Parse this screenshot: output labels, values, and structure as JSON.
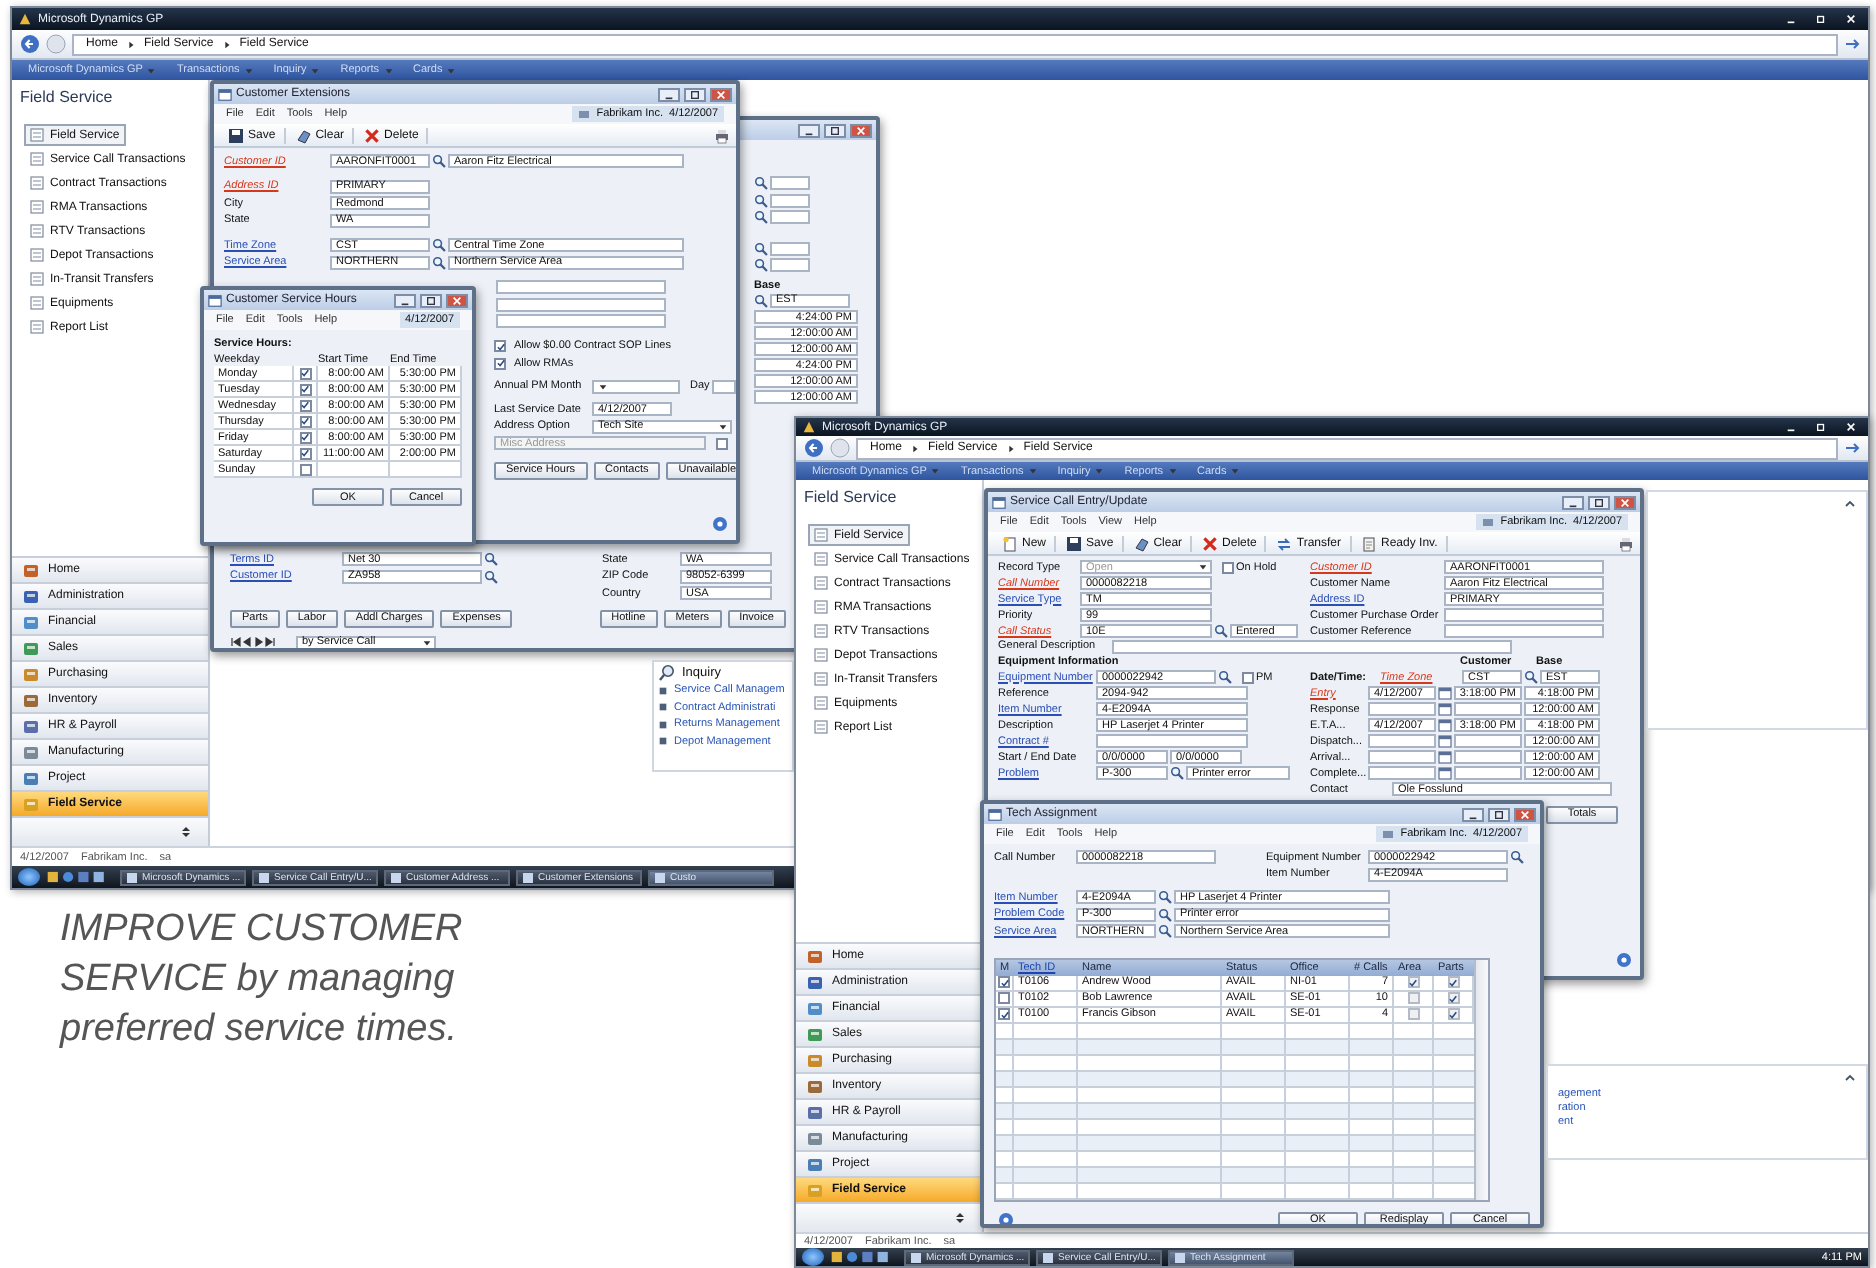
{
  "caption": "IMPROVE CUSTOMER SERVICE by managing preferred service times.",
  "screens": [
    {
      "title": "Microsoft Dynamics GP",
      "breadcrumb": [
        "Home",
        "Field Service",
        "Field Service"
      ],
      "menu": [
        "Microsoft Dynamics GP",
        "Transactions",
        "Inquiry",
        "Reports",
        "Cards"
      ],
      "pane_title": "Field Service",
      "nav_items": [
        {
          "label": "Field Service",
          "selected": true
        },
        {
          "label": "Service Call Transactions",
          "selected": false
        },
        {
          "label": "Contract Transactions",
          "selected": false
        },
        {
          "label": "RMA Transactions",
          "selected": false
        },
        {
          "label": "RTV Transactions",
          "selected": false
        },
        {
          "label": "Depot Transactions",
          "selected": false
        },
        {
          "label": "In-Transit Transfers",
          "selected": false
        },
        {
          "label": "Equipments",
          "selected": false
        },
        {
          "label": "Report List",
          "selected": false
        }
      ],
      "modules": [
        {
          "label": "Home",
          "selected": false
        },
        {
          "label": "Administration",
          "selected": false
        },
        {
          "label": "Financial",
          "selected": false
        },
        {
          "label": "Sales",
          "selected": false
        },
        {
          "label": "Purchasing",
          "selected": false
        },
        {
          "label": "Inventory",
          "selected": false
        },
        {
          "label": "HR & Payroll",
          "selected": false
        },
        {
          "label": "Manufacturing",
          "selected": false
        },
        {
          "label": "Project",
          "selected": false
        },
        {
          "label": "Field Service",
          "selected": true
        }
      ],
      "status_bar": [
        "4/12/2007",
        "Fabrikam Inc.",
        "sa"
      ],
      "taskbar": [
        {
          "label": "Microsoft Dynamics ...",
          "selected": false
        },
        {
          "label": "Service Call Entry/U...",
          "selected": false
        },
        {
          "label": "Customer Address ...",
          "selected": false
        },
        {
          "label": "Customer Extensions",
          "selected": false
        },
        {
          "label": "Custo",
          "selected": true
        }
      ],
      "windows": [
        {
          "kind": "service_call_partial",
          "base_label": "Base",
          "base_value": "EST",
          "times": [
            "4:24:00 PM",
            "12:00:00 AM",
            "12:00:00 AM",
            "4:24:00 PM",
            "12:00:00 AM",
            "12:00:00 AM"
          ],
          "left_rows": [
            {
              "label": "Terms ID",
              "kind": "link",
              "value": "Net 30"
            },
            {
              "label": "Customer ID",
              "kind": "link",
              "value": "ZA958"
            }
          ],
          "right_rows": [
            {
              "label": "State",
              "kind": "plain",
              "value": "WA"
            },
            {
              "label": "ZIP Code",
              "kind": "plain",
              "value": "98052-6399"
            },
            {
              "label": "Country",
              "kind": "plain",
              "value": "USA"
            }
          ],
          "buttons_left": [
            "Parts",
            "Labor",
            "Addl Charges",
            "Expenses"
          ],
          "buttons_right": [
            "Hotline",
            "Meters",
            "Invoice"
          ],
          "browse": "by Service Call"
        },
        {
          "kind": "customer_extensions",
          "title": "Customer Extensions",
          "menu": [
            "File",
            "Edit",
            "Tools",
            "Help"
          ],
          "company": "Fabrikam Inc.",
          "date": "4/12/2007",
          "toolbar": [
            {
              "label": "Save",
              "kind": "save"
            },
            {
              "label": "Clear",
              "kind": "clear"
            },
            {
              "label": "Delete",
              "kind": "delete"
            }
          ],
          "field_groups": [
            [
              {
                "label": "Customer ID",
                "kind": "required",
                "value": "AARONFIT0001",
                "desc": "Aaron Fitz Electrical"
              }
            ],
            [
              {
                "label": "Address ID",
                "kind": "required",
                "value": "PRIMARY"
              },
              {
                "label": "City",
                "kind": "plain",
                "value": "Redmond"
              },
              {
                "label": "State",
                "kind": "plain",
                "value": "WA"
              }
            ],
            [
              {
                "label": "Time Zone",
                "kind": "link",
                "value": "CST",
                "desc": "Central Time Zone"
              },
              {
                "label": "Service Area",
                "kind": "link",
                "value": "NORTHERN",
                "desc": "Northern Service Area"
              }
            ]
          ],
          "checks": [
            {
              "label": "Allow $0.00 Contract SOP Lines",
              "checked": true
            },
            {
              "label": "Allow RMAs",
              "checked": true
            }
          ],
          "pm_month_label": "Annual PM Month",
          "day_label": "Day",
          "last_service_label": "Last Service Date",
          "last_service": "4/12/2007",
          "address_option_label": "Address Option",
          "address_option": "Tech Site",
          "misc_address_label": "Misc Address",
          "misc_checked": false,
          "buttons": [
            "Service Hours",
            "Contacts",
            "Unavailable"
          ]
        },
        {
          "kind": "service_hours",
          "title": "Customer Service Hours",
          "menu": [
            "File",
            "Edit",
            "Tools",
            "Help"
          ],
          "date": "4/12/2007",
          "heading": "Service Hours:",
          "columns": [
            "Weekday",
            "Start Time",
            "End Time"
          ],
          "rows": [
            {
              "day": "Monday",
              "checked": true,
              "start": "8:00:00 AM",
              "end": "5:30:00 PM"
            },
            {
              "day": "Tuesday",
              "checked": true,
              "start": "8:00:00 AM",
              "end": "5:30:00 PM"
            },
            {
              "day": "Wednesday",
              "checked": true,
              "start": "8:00:00 AM",
              "end": "5:30:00 PM"
            },
            {
              "day": "Thursday",
              "checked": true,
              "start": "8:00:00 AM",
              "end": "5:30:00 PM"
            },
            {
              "day": "Friday",
              "checked": true,
              "start": "8:00:00 AM",
              "end": "5:30:00 PM"
            },
            {
              "day": "Saturday",
              "checked": true,
              "start": "11:00:00 AM",
              "end": "2:00:00 PM"
            },
            {
              "day": "Sunday",
              "checked": false
            }
          ],
          "buttons": [
            "OK",
            "Cancel"
          ]
        },
        {
          "kind": "inquiry",
          "title": "Inquiry",
          "links": [
            "Service Call Managem",
            "Contract Administrati",
            "Returns Management",
            "Depot Management"
          ]
        }
      ]
    },
    {
      "title": "Microsoft Dynamics GP",
      "breadcrumb": [
        "Home",
        "Field Service",
        "Field Service"
      ],
      "menu": [
        "Microsoft Dynamics GP",
        "Transactions",
        "Inquiry",
        "Reports",
        "Cards"
      ],
      "pane_title": "Field Service",
      "nav_items": [
        {
          "label": "Field Service",
          "selected": true
        },
        {
          "label": "Service Call Transactions",
          "selected": false
        },
        {
          "label": "Contract Transactions",
          "selected": false
        },
        {
          "label": "RMA Transactions",
          "selected": false
        },
        {
          "label": "RTV Transactions",
          "selected": false
        },
        {
          "label": "Depot Transactions",
          "selected": false
        },
        {
          "label": "In-Transit Transfers",
          "selected": false
        },
        {
          "label": "Equipments",
          "selected": false
        },
        {
          "label": "Report List",
          "selected": false
        }
      ],
      "modules": [
        {
          "label": "Home",
          "selected": false
        },
        {
          "label": "Administration",
          "selected": false
        },
        {
          "label": "Financial",
          "selected": false
        },
        {
          "label": "Sales",
          "selected": false
        },
        {
          "label": "Purchasing",
          "selected": false
        },
        {
          "label": "Inventory",
          "selected": false
        },
        {
          "label": "HR & Payroll",
          "selected": false
        },
        {
          "label": "Manufacturing",
          "selected": false
        },
        {
          "label": "Project",
          "selected": false
        },
        {
          "label": "Field Service",
          "selected": true
        }
      ],
      "status_bar": [
        "4/12/2007",
        "Fabrikam Inc.",
        "sa"
      ],
      "taskbar": [
        {
          "label": "Microsoft Dynamics ...",
          "selected": false
        },
        {
          "label": "Service Call Entry/U...",
          "selected": false
        },
        {
          "label": "Tech Assignment",
          "selected": true
        }
      ],
      "clock": "4:11 PM",
      "windows": [
        {
          "kind": "service_call_entry",
          "title": "Service Call Entry/Update",
          "menu": [
            "File",
            "Edit",
            "Tools",
            "View",
            "Help"
          ],
          "company": "Fabrikam Inc.",
          "date": "4/12/2007",
          "toolbar": [
            {
              "label": "New",
              "kind": "new"
            },
            {
              "label": "Save",
              "kind": "save"
            },
            {
              "label": "Clear",
              "kind": "clear"
            },
            {
              "label": "Delete",
              "kind": "delete"
            },
            {
              "label": "Transfer",
              "kind": "transfer"
            },
            {
              "label": "Ready Inv.",
              "kind": "document"
            }
          ],
          "record_type_label": "Record Type",
          "record_type": "Open",
          "on_hold_label": "On Hold",
          "on_hold": false,
          "left_fields": [
            {
              "label": "Call Number",
              "kind": "required",
              "value": "0000082218"
            },
            {
              "label": "Service Type",
              "kind": "link",
              "value": "TM"
            },
            {
              "label": "Priority",
              "kind": "plain",
              "value": "99"
            },
            {
              "label": "Call Status",
              "kind": "required",
              "value": "10E",
              "desc": "Entered"
            }
          ],
          "right_fields": [
            {
              "label": "Customer ID",
              "kind": "required",
              "value": "AARONFIT0001"
            },
            {
              "label": "Customer Name",
              "kind": "plain",
              "value": "Aaron Fitz Electrical"
            },
            {
              "label": "Address ID",
              "kind": "link",
              "value": "PRIMARY"
            },
            {
              "label": "Customer Purchase Order",
              "kind": "plain"
            },
            {
              "label": "Customer Reference",
              "kind": "plain"
            }
          ],
          "description_label": "General Description",
          "equipment_heading": "Equipment Information",
          "pm_label": "PM",
          "pm": false,
          "equipment_fields": [
            {
              "label": "Equipment Number",
              "kind": "link",
              "value": "0000022942"
            },
            {
              "label": "Reference",
              "kind": "plain",
              "value": "2094-942"
            },
            {
              "label": "Item Number",
              "kind": "link",
              "value": "4-E2094A"
            },
            {
              "label": "Description",
              "kind": "plain",
              "value": "HP Laserjet 4 Printer"
            },
            {
              "label": "Contract #",
              "kind": "link"
            }
          ],
          "start_end_label": "Start / End Date",
          "start_date": "0/0/0000",
          "end_date": "0/0/0000",
          "datetime_heading": "Date/Time:",
          "timezone_label": "Time Zone",
          "customer_label": "Customer",
          "base_label": "Base",
          "customer_tz": "CST",
          "base_tz": "EST",
          "times": [
            {
              "label": "Entry",
              "kind": "required",
              "date": "4/12/2007",
              "customer": "3:18:00 PM",
              "base": "4:18:00 PM"
            },
            {
              "label": "Response",
              "kind": "plain",
              "base": "12:00:00 AM"
            },
            {
              "label": "E.T.A...",
              "kind": "plain",
              "date": "4/12/2007",
              "customer": "3:18:00 PM",
              "base": "4:18:00 PM"
            },
            {
              "label": "Dispatch...",
              "kind": "plain",
              "base": "12:00:00 AM"
            },
            {
              "label": "Arrival...",
              "kind": "plain",
              "base": "12:00:00 AM"
            },
            {
              "label": "Complete...",
              "kind": "plain",
              "base": "12:00:00 AM"
            }
          ],
          "problem": {
            "label": "Problem",
            "kind": "link",
            "value": "P-300",
            "desc": "Printer error"
          },
          "contact": {
            "label": "Contact",
            "kind": "plain",
            "value": "Ole Fosslund"
          },
          "totals": "Totals"
        },
        {
          "kind": "tech_assignment",
          "title": "Tech Assignment",
          "menu": [
            "File",
            "Edit",
            "Tools",
            "Help"
          ],
          "company": "Fabrikam Inc.",
          "date": "4/12/2007",
          "call_number_label": "Call Number",
          "call_number": "0000082218",
          "equipment_number_label": "Equipment Number",
          "equipment_number": "0000022942",
          "item_label": "Item Number",
          "item_number": "4-E2094A",
          "fields": [
            {
              "label": "Item Number",
              "kind": "link",
              "value": "4-E2094A",
              "desc": "HP Laserjet 4 Printer"
            },
            {
              "label": "Problem Code",
              "kind": "link",
              "value": "P-300",
              "desc": "Printer error"
            },
            {
              "label": "Service Area",
              "kind": "link",
              "value": "NORTHERN",
              "desc": "Northern Service Area"
            }
          ],
          "columns": [
            {
              "label": "M",
              "kind": "plain"
            },
            {
              "label": "Tech ID",
              "kind": "link"
            },
            {
              "label": "Name",
              "kind": "plain"
            },
            {
              "label": "Status",
              "kind": "plain"
            },
            {
              "label": "Office",
              "kind": "plain"
            },
            {
              "label": "# Calls",
              "kind": "plain"
            },
            {
              "label": "Area",
              "kind": "plain"
            },
            {
              "label": "Parts",
              "kind": "plain"
            }
          ],
          "rows": [
            {
              "checked": true,
              "tech_id": "T0106",
              "name": "Andrew Wood",
              "status": "AVAIL",
              "office": "NI-01",
              "calls": "7",
              "area": true,
              "parts": true
            },
            {
              "checked": false,
              "tech_id": "T0102",
              "name": "Bob Lawrence",
              "status": "AVAIL",
              "office": "SE-01",
              "calls": "10",
              "area": false,
              "parts": true
            },
            {
              "checked": true,
              "tech_id": "T0100",
              "name": "Francis Gibson",
              "status": "AVAIL",
              "office": "SE-01",
              "calls": "4",
              "area": false,
              "parts": true
            }
          ],
          "buttons": [
            "OK",
            "Redisplay",
            "Cancel"
          ]
        },
        {
          "kind": "side_panels",
          "links": [
            "agement",
            "ration",
            "ent"
          ]
        }
      ]
    }
  ]
}
